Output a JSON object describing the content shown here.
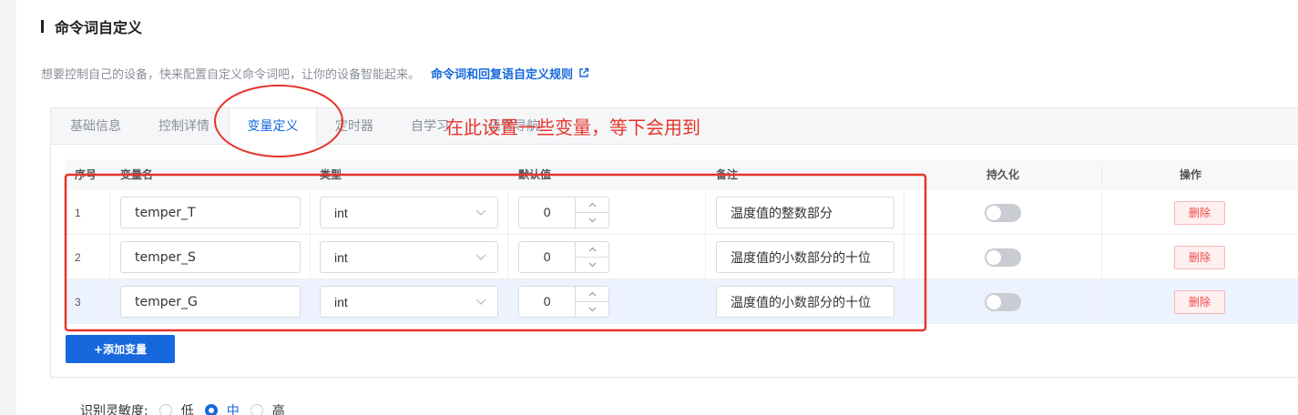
{
  "section": {
    "title": "命令词自定义",
    "description": "想要控制自己的设备，快来配置自定义命令词吧，让你的设备智能起来。",
    "rule_link": "命令词和回复语自定义规则"
  },
  "tabs": [
    {
      "label": "基础信息",
      "active": false
    },
    {
      "label": "控制详情",
      "active": false
    },
    {
      "label": "变量定义",
      "active": true
    },
    {
      "label": "定时器",
      "active": false
    },
    {
      "label": "自学习",
      "active": false
    },
    {
      "label": "语音导航",
      "active": false
    }
  ],
  "table": {
    "columns": [
      "序号",
      "变量名",
      "类型",
      "默认值",
      "备注",
      "持久化",
      "操作"
    ],
    "rows": [
      {
        "index": "1",
        "name": "temper_T",
        "type": "int",
        "default": "0",
        "note": "温度值的整数部分",
        "persist": false,
        "action": "删除"
      },
      {
        "index": "2",
        "name": "temper_S",
        "type": "int",
        "default": "0",
        "note": "温度值的小数部分的十位",
        "persist": false,
        "action": "删除"
      },
      {
        "index": "3",
        "name": "temper_G",
        "type": "int",
        "default": "0",
        "note": "温度值的小数部分的十位",
        "persist": false,
        "action": "删除"
      }
    ]
  },
  "add_button": "+添加变量",
  "sensitivity": {
    "label": "识别灵敏度:",
    "options": [
      {
        "label": "低",
        "checked": false
      },
      {
        "label": "中",
        "checked": true
      },
      {
        "label": "高",
        "checked": false
      }
    ]
  },
  "annotation": {
    "text": "在此设置一些变量，等下会用到",
    "color": "#e5352b"
  },
  "colors": {
    "accent": "#1668dc",
    "danger": "#f04848",
    "highlight_row": "#edf3fe"
  },
  "icons": {
    "rule_link": "external-link-icon",
    "select": "chevron-down-icon",
    "stepper_up": "chevron-up-icon",
    "stepper_down": "chevron-down-icon"
  }
}
